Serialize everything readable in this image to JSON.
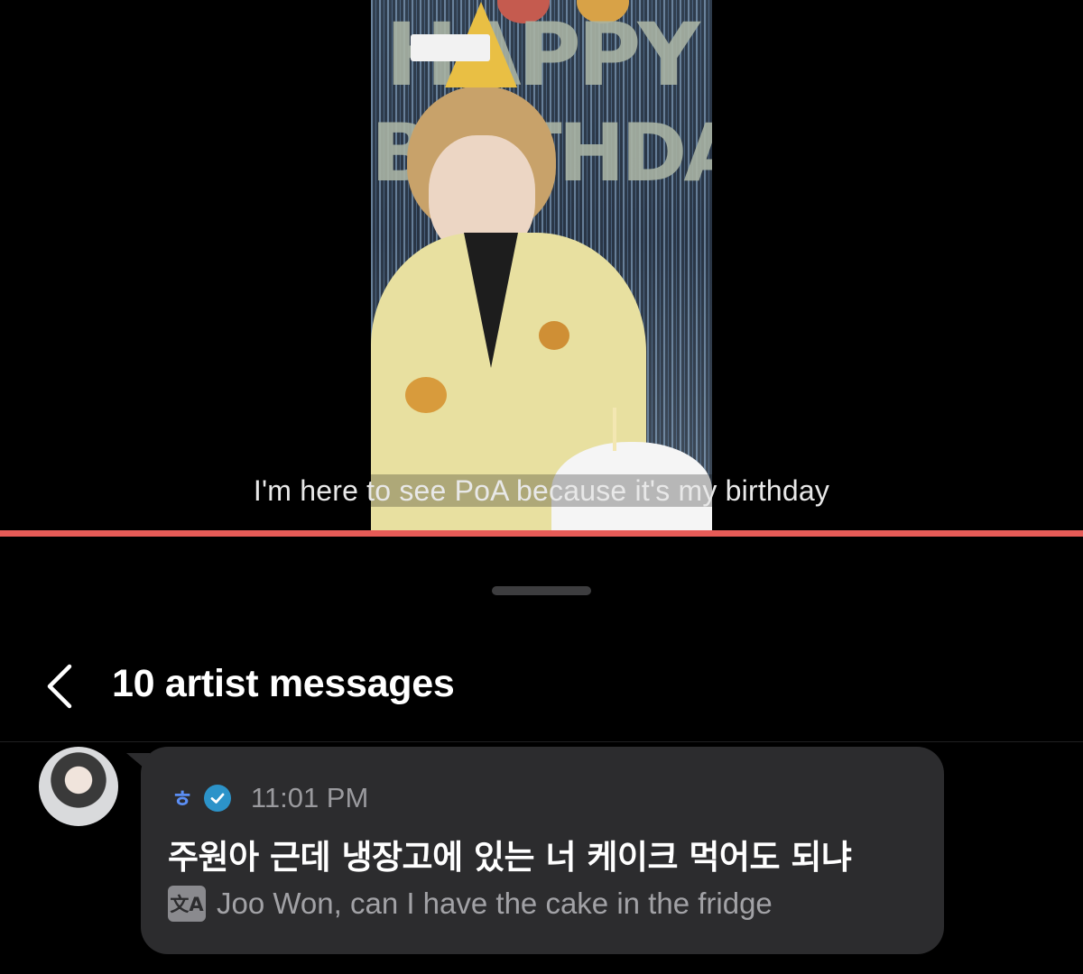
{
  "video": {
    "caption": "I'm here to see PoA because it's my birthday",
    "banner_line1": "HAPPY",
    "banner_line2": "BIRTHDAY",
    "hat_text": "HAPPY BIRTHDAY",
    "progress_fraction": 0.0
  },
  "header": {
    "title": "10 artist messages",
    "back_icon": "chevron-left-icon"
  },
  "message": {
    "sender": "ㅎ",
    "time": "11:01 PM",
    "text": "주원아 근데 냉장고에 있는 너 케이크 먹어도 되냐",
    "translation": "Joo Won, can I have the cake in the fridge",
    "translate_icon_glyph": "文A",
    "verified_icon": "verified-check-icon"
  },
  "colors": {
    "background": "#000000",
    "progress": "#e65b57",
    "bubble": "#2c2c2e",
    "sender": "#5b8ef4",
    "verified": "#2c93c9"
  }
}
